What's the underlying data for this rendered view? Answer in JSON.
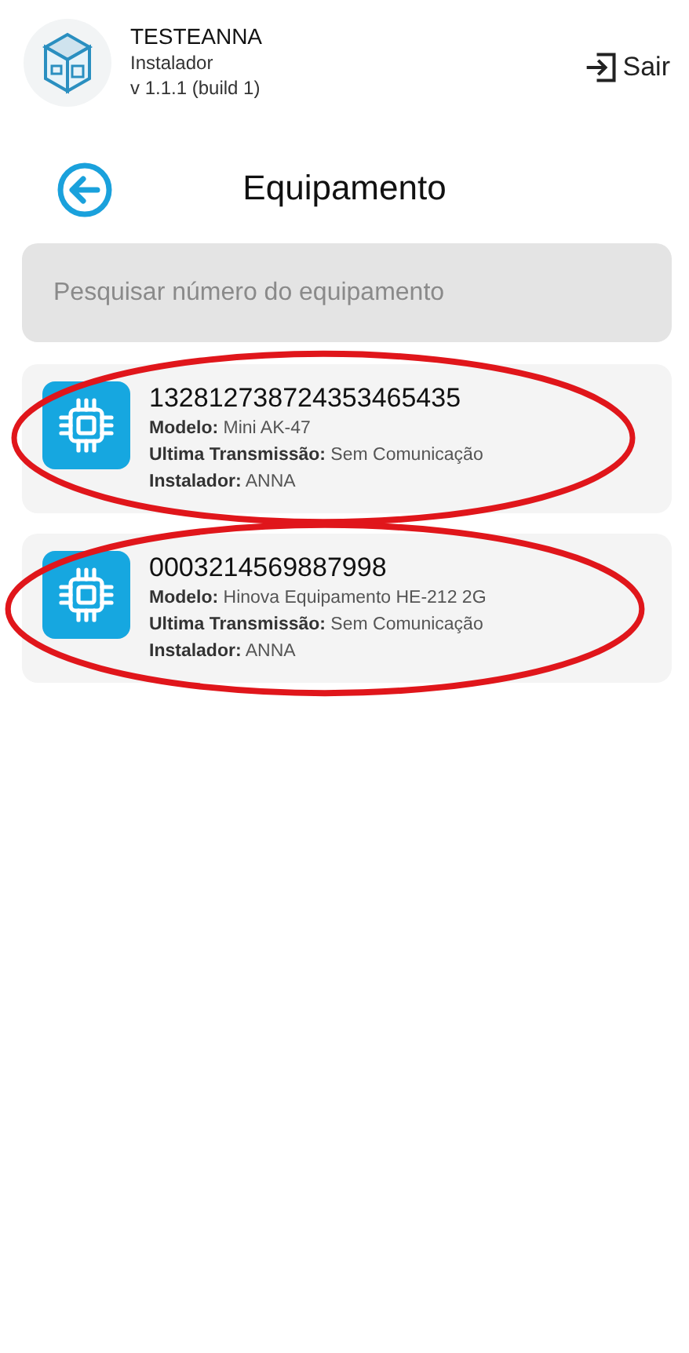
{
  "header": {
    "app_name": "TESTEANNA",
    "role": "Instalador",
    "version": "v 1.1.1 (build 1)",
    "logout": "Sair"
  },
  "page": {
    "title": "Equipamento"
  },
  "search": {
    "placeholder": "Pesquisar número do equipamento"
  },
  "devices": [
    {
      "number": "132812738724353465435",
      "lines": [
        "**Modelo:** Mini AK-47",
        "**Ultima Transmissão:** Sem Comunicação",
        "**Instalador:** ANNA"
      ]
    },
    {
      "number": "0003214569887998",
      "lines": [
        "**Modelo:** Hinova Equipamento HE-212 2G",
        "**Ultima Transmissão:** Sem Comunicação",
        "**Instalador:** ANNA"
      ]
    }
  ]
}
